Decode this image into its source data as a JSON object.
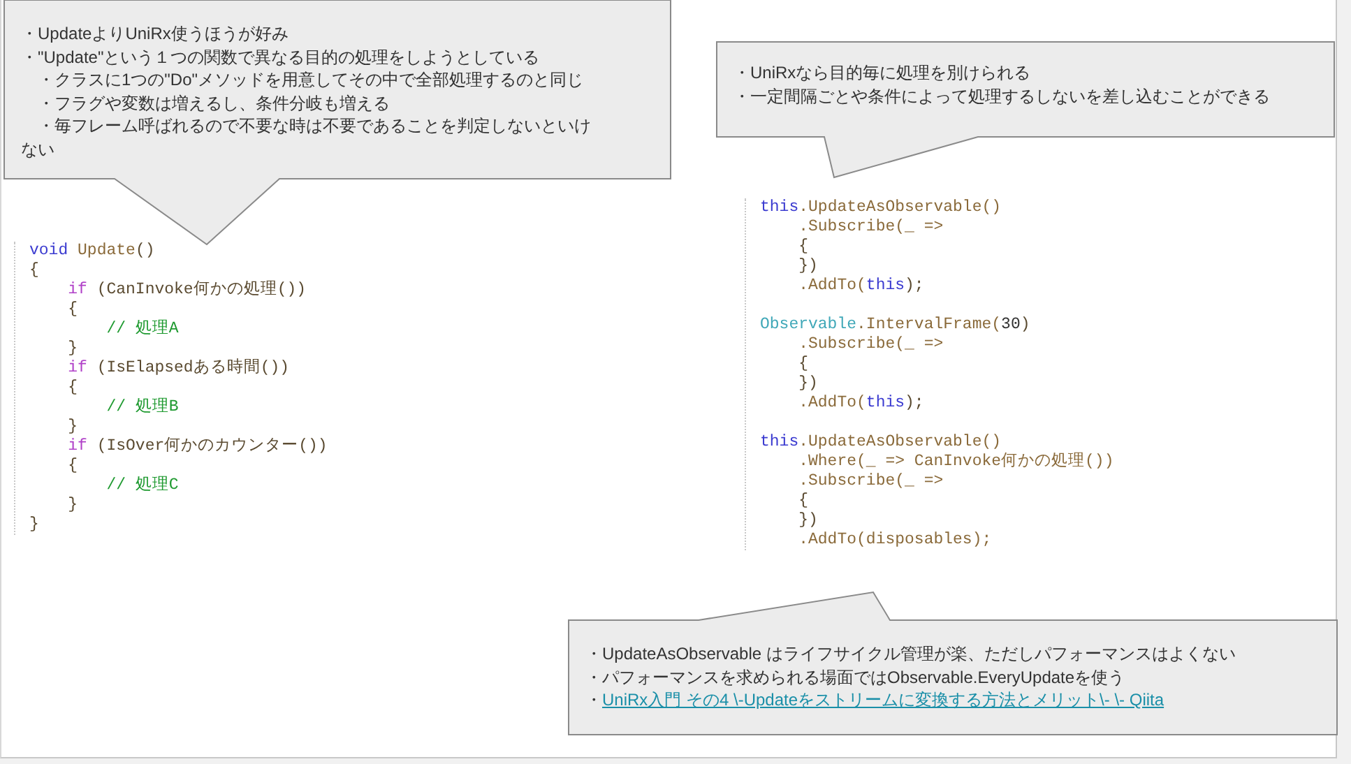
{
  "code_left": [
    {
      "tokens": [
        {
          "text": "void ",
          "kind": "keyword"
        },
        {
          "text": "Update",
          "kind": "method"
        },
        {
          "text": "()",
          "kind": "punct"
        }
      ]
    },
    {
      "tokens": [
        {
          "text": "{",
          "kind": "punct"
        }
      ]
    },
    {
      "tokens": [
        {
          "text": "    if ",
          "kind": "control"
        },
        {
          "text": "(CanInvoke何かの処理())",
          "kind": "punct"
        }
      ]
    },
    {
      "tokens": [
        {
          "text": "    {",
          "kind": "punct"
        }
      ]
    },
    {
      "tokens": [
        {
          "text": "        // 処理A",
          "kind": "comment"
        }
      ]
    },
    {
      "tokens": [
        {
          "text": "    }",
          "kind": "punct"
        }
      ]
    },
    {
      "tokens": [
        {
          "text": "    if ",
          "kind": "control"
        },
        {
          "text": "(IsElapsedある時間())",
          "kind": "punct"
        }
      ]
    },
    {
      "tokens": [
        {
          "text": "    {",
          "kind": "punct"
        }
      ]
    },
    {
      "tokens": [
        {
          "text": "        // 処理B",
          "kind": "comment"
        }
      ]
    },
    {
      "tokens": [
        {
          "text": "    }",
          "kind": "punct"
        }
      ]
    },
    {
      "tokens": [
        {
          "text": "    if ",
          "kind": "control"
        },
        {
          "text": "(IsOver何かのカウンター())",
          "kind": "punct"
        }
      ]
    },
    {
      "tokens": [
        {
          "text": "    {",
          "kind": "punct"
        }
      ]
    },
    {
      "tokens": [
        {
          "text": "        // 処理C",
          "kind": "comment"
        }
      ]
    },
    {
      "tokens": [
        {
          "text": "    }",
          "kind": "punct"
        }
      ]
    },
    {
      "tokens": [
        {
          "text": "}",
          "kind": "punct"
        }
      ]
    }
  ],
  "code_right": [
    {
      "lines": [
        {
          "tokens": [
            {
              "text": "this",
              "kind": "keyword"
            },
            {
              "text": ".UpdateAsObservable()",
              "kind": "method"
            }
          ]
        },
        {
          "tokens": [
            {
              "text": "    .Subscribe(_ =>",
              "kind": "method"
            }
          ]
        },
        {
          "tokens": [
            {
              "text": "    {",
              "kind": "punct"
            }
          ]
        },
        {
          "tokens": [
            {
              "text": "    })",
              "kind": "punct"
            }
          ]
        },
        {
          "tokens": [
            {
              "text": "    .AddTo(",
              "kind": "method"
            },
            {
              "text": "this",
              "kind": "keyword"
            },
            {
              "text": ");",
              "kind": "punct"
            }
          ]
        }
      ]
    },
    {
      "lines": [
        {
          "tokens": [
            {
              "text": "Observable",
              "kind": "type"
            },
            {
              "text": ".IntervalFrame(",
              "kind": "method"
            },
            {
              "text": "30",
              "kind": "number"
            },
            {
              "text": ")",
              "kind": "punct"
            }
          ]
        },
        {
          "tokens": [
            {
              "text": "    .Subscribe(_ =>",
              "kind": "method"
            }
          ]
        },
        {
          "tokens": [
            {
              "text": "    {",
              "kind": "punct"
            }
          ]
        },
        {
          "tokens": [
            {
              "text": "    })",
              "kind": "punct"
            }
          ]
        },
        {
          "tokens": [
            {
              "text": "    .AddTo(",
              "kind": "method"
            },
            {
              "text": "this",
              "kind": "keyword"
            },
            {
              "text": ");",
              "kind": "punct"
            }
          ]
        }
      ]
    },
    {
      "lines": [
        {
          "tokens": [
            {
              "text": "this",
              "kind": "keyword"
            },
            {
              "text": ".UpdateAsObservable()",
              "kind": "method"
            }
          ]
        },
        {
          "tokens": [
            {
              "text": "    .Where(_ => CanInvoke何かの処理())",
              "kind": "method"
            }
          ]
        },
        {
          "tokens": [
            {
              "text": "    .Subscribe(_ =>",
              "kind": "method"
            }
          ]
        },
        {
          "tokens": [
            {
              "text": "    {",
              "kind": "punct"
            }
          ]
        },
        {
          "tokens": [
            {
              "text": "    })",
              "kind": "punct"
            }
          ]
        },
        {
          "tokens": [
            {
              "text": "    .AddTo(disposables);",
              "kind": "method"
            }
          ]
        }
      ]
    }
  ],
  "callouts": [
    {
      "lines": [
        {
          "kind": "text",
          "text": "・UpdateよりUniRx使うほうが好み"
        },
        {
          "kind": "text",
          "text": "・\"Update\"という１つの関数で異なる目的の処理をしようとしている"
        },
        {
          "kind": "text",
          "text": "　・クラスに1つの\"Do\"メソッドを用意してその中で全部処理するのと同じ"
        },
        {
          "kind": "text",
          "text": "　・フラグや変数は増えるし、条件分岐も増える"
        },
        {
          "kind": "text",
          "text": "　・毎フレーム呼ばれるので不要な時は不要であることを判定しないといけ"
        },
        {
          "kind": "text",
          "text": "ない"
        }
      ]
    },
    {
      "lines": [
        {
          "kind": "text",
          "text": "・UniRxなら目的毎に処理を別けられる"
        },
        {
          "kind": "text",
          "text": "・一定間隔ごとや条件によって処理するしないを差し込むことができる"
        }
      ]
    },
    {
      "lines": [
        {
          "kind": "text",
          "text": "・UpdateAsObservable はライフサイクル管理が楽、ただしパフォーマンスはよくない"
        },
        {
          "kind": "text",
          "text": "・パフォーマンスを求められる場面ではObservable.EveryUpdateを使う"
        },
        {
          "kind": "link",
          "prefix": "・",
          "text": "UniRx入門 その4 \\-Updateをストリームに変換する方法とメリット\\- \\- Qiita"
        }
      ]
    }
  ]
}
